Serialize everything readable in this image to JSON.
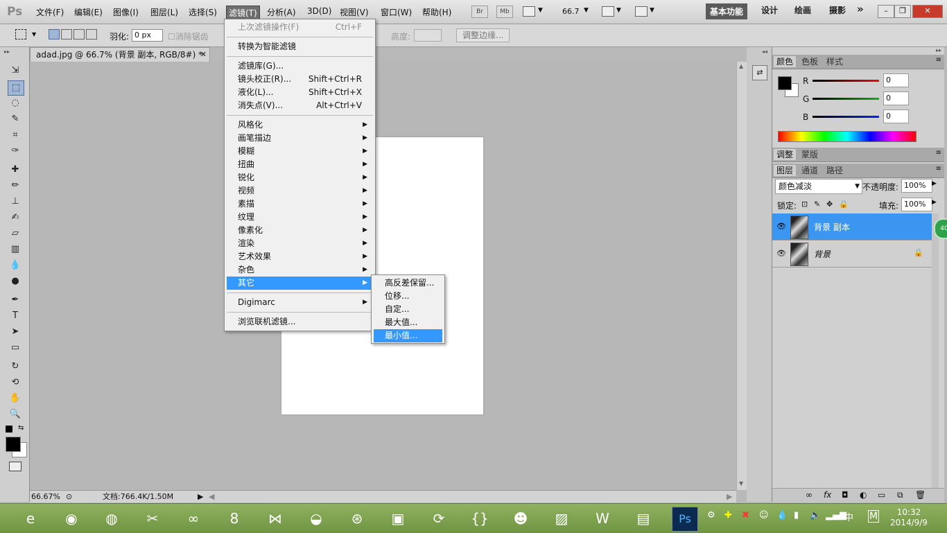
{
  "app": {
    "logo": "Ps"
  },
  "menubar": {
    "items": [
      "文件(F)",
      "编辑(E)",
      "图像(I)",
      "图层(L)",
      "选择(S)",
      "滤镜(T)",
      "分析(A)",
      "3D(D)",
      "视图(V)",
      "窗口(W)",
      "帮助(H)"
    ],
    "active": "滤镜(T)",
    "mini_buttons": [
      "Br",
      "Mb"
    ],
    "zoom": "66.7",
    "workspaces": [
      "基本功能",
      "设计",
      "绘画",
      "摄影"
    ],
    "more": "»"
  },
  "options": {
    "feather_label": "羽化:",
    "feather_value": "0 px",
    "antialias_label": "消除锯齿",
    "height_label": "高度:",
    "refine_edge": "调整边缘..."
  },
  "document": {
    "tab_title": "adad.jpg @ 66.7% (背景 副本, RGB/8#) *",
    "zoom_status": "66.67%",
    "doc_status": "文档:766.4K/1.50M"
  },
  "filter_menu": {
    "items": [
      {
        "label": "上次滤镜操作(F)",
        "shortcut": "Ctrl+F",
        "disabled": true
      },
      {
        "sep": true
      },
      {
        "label": "转换为智能滤镜"
      },
      {
        "sep": true
      },
      {
        "label": "滤镜库(G)..."
      },
      {
        "label": "镜头校正(R)...",
        "shortcut": "Shift+Ctrl+R"
      },
      {
        "label": "液化(L)...",
        "shortcut": "Shift+Ctrl+X"
      },
      {
        "label": "消失点(V)...",
        "shortcut": "Alt+Ctrl+V"
      },
      {
        "sep": true
      },
      {
        "label": "风格化",
        "submenu": true
      },
      {
        "label": "画笔描边",
        "submenu": true
      },
      {
        "label": "模糊",
        "submenu": true
      },
      {
        "label": "扭曲",
        "submenu": true
      },
      {
        "label": "锐化",
        "submenu": true
      },
      {
        "label": "视频",
        "submenu": true
      },
      {
        "label": "素描",
        "submenu": true
      },
      {
        "label": "纹理",
        "submenu": true
      },
      {
        "label": "像素化",
        "submenu": true
      },
      {
        "label": "渲染",
        "submenu": true
      },
      {
        "label": "艺术效果",
        "submenu": true
      },
      {
        "label": "杂色",
        "submenu": true
      },
      {
        "label": "其它",
        "submenu": true,
        "highlighted": true
      },
      {
        "sep": true
      },
      {
        "label": "Digimarc",
        "submenu": true
      },
      {
        "sep": true
      },
      {
        "label": "浏览联机滤镜..."
      }
    ]
  },
  "other_submenu": {
    "items": [
      {
        "label": "高反差保留..."
      },
      {
        "label": "位移..."
      },
      {
        "label": "自定..."
      },
      {
        "label": "最大值..."
      },
      {
        "label": "最小值...",
        "highlighted": true
      }
    ]
  },
  "color_panel": {
    "tabs": [
      "颜色",
      "色板",
      "样式"
    ],
    "channels": [
      {
        "name": "R",
        "value": "0",
        "color": "#e01010"
      },
      {
        "name": "G",
        "value": "0",
        "color": "#10b010"
      },
      {
        "name": "B",
        "value": "0",
        "color": "#1020e0"
      }
    ]
  },
  "adjust_panel": {
    "tabs": [
      "调整",
      "蒙版"
    ]
  },
  "layers_panel": {
    "tabs": [
      "图层",
      "通道",
      "路径"
    ],
    "blend_mode": "颜色减淡",
    "opacity_label": "不透明度:",
    "opacity": "100%",
    "lock_label": "锁定:",
    "fill_label": "填充:",
    "fill": "100%",
    "layers": [
      {
        "name": "背景 副本",
        "selected": true
      },
      {
        "name": "背景",
        "locked": true
      }
    ],
    "badge": "40"
  },
  "taskbar": {
    "icons": [
      "ie-icon",
      "chrome-icon",
      "firefox-icon",
      "tools-icon",
      "infinity-icon",
      "app8-icon",
      "visualstudio-icon",
      "eclipse-icon",
      "media-icon",
      "folder-icon",
      "sync-icon",
      "braces-icon",
      "avatar-icon",
      "photo-icon",
      "word-icon",
      "notes-icon",
      "photoshop-icon"
    ],
    "clock_time": "10:32",
    "clock_date": "2014/9/9",
    "ime": "中",
    "ime2": "M"
  },
  "colors": {
    "accent": "#3399ff",
    "layer_select": "#3b96f2",
    "taskbar": "#7ea352"
  }
}
